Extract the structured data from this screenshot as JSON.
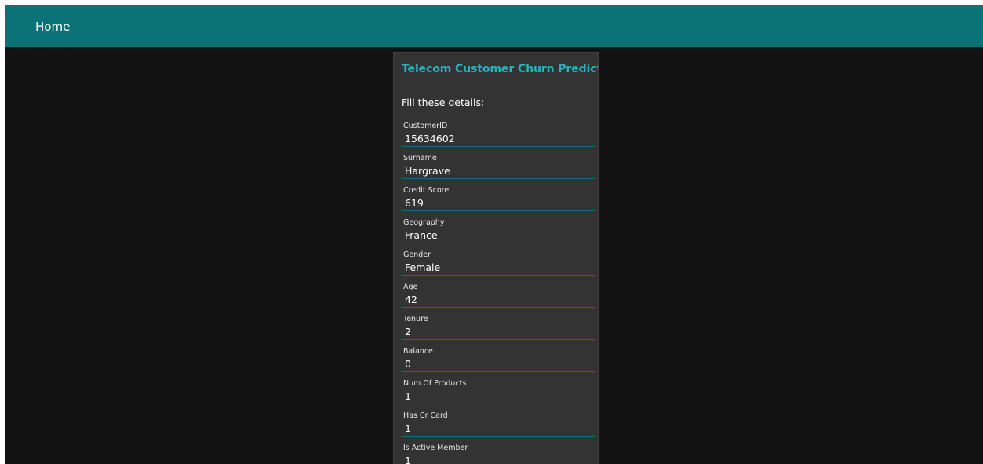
{
  "navbar": {
    "home_label": "Home"
  },
  "form": {
    "title": "Telecom Customer Churn Predictor",
    "subtitle": "Fill these details:",
    "fields": [
      {
        "label": "CustomerID",
        "value": "15634602"
      },
      {
        "label": "Surname",
        "value": "Hargrave"
      },
      {
        "label": "Credit Score",
        "value": "619"
      },
      {
        "label": "Geography",
        "value": "France"
      },
      {
        "label": "Gender",
        "value": "Female"
      },
      {
        "label": "Age",
        "value": "42"
      },
      {
        "label": "Tenure",
        "value": "2"
      },
      {
        "label": "Balance",
        "value": "0"
      },
      {
        "label": "Num Of Products",
        "value": "1"
      },
      {
        "label": "Has Cr Card",
        "value": "1"
      },
      {
        "label": "Is Active Member",
        "value": "1"
      }
    ]
  },
  "colors": {
    "navbar": "#0b7277",
    "background": "#121212",
    "card": "#333333",
    "accent": "#26b2be"
  }
}
